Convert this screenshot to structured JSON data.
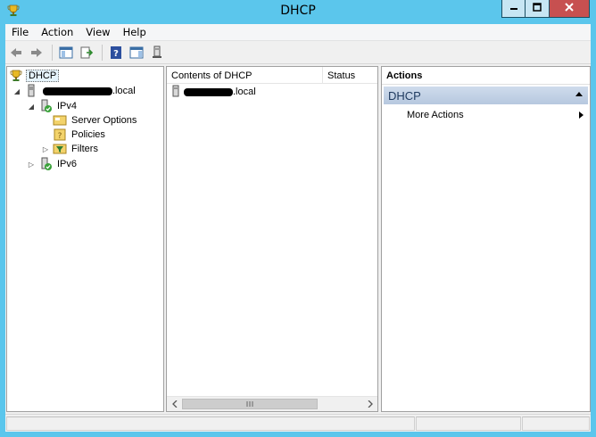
{
  "window": {
    "title": "DHCP",
    "app_icon": "dhcp-trophy-icon",
    "controls": [
      "minimize-icon",
      "maximize-icon",
      "close-icon"
    ]
  },
  "menu": {
    "items": [
      "File",
      "Action",
      "View",
      "Help"
    ]
  },
  "toolbar": {
    "buttons": [
      "back-arrow-icon",
      "forward-arrow-icon",
      "show-hide-tree-icon",
      "export-list-icon",
      "help-icon",
      "properties-pane-icon",
      "server-icon"
    ]
  },
  "tree": {
    "root": "DHCP",
    "server": ".local",
    "ipv4": "IPv4",
    "server_options": "Server Options",
    "policies": "Policies",
    "filters": "Filters",
    "ipv6": "IPv6"
  },
  "list": {
    "columns": [
      "Contents of DHCP",
      "Status"
    ],
    "rows": [
      ".local"
    ]
  },
  "actions": {
    "header": "Actions",
    "group": "DHCP",
    "items": [
      "More Actions"
    ]
  },
  "colors": {
    "titlebar": "#5bc6ec",
    "close_button": "#c75050",
    "actions_group": "#b6c8df"
  }
}
